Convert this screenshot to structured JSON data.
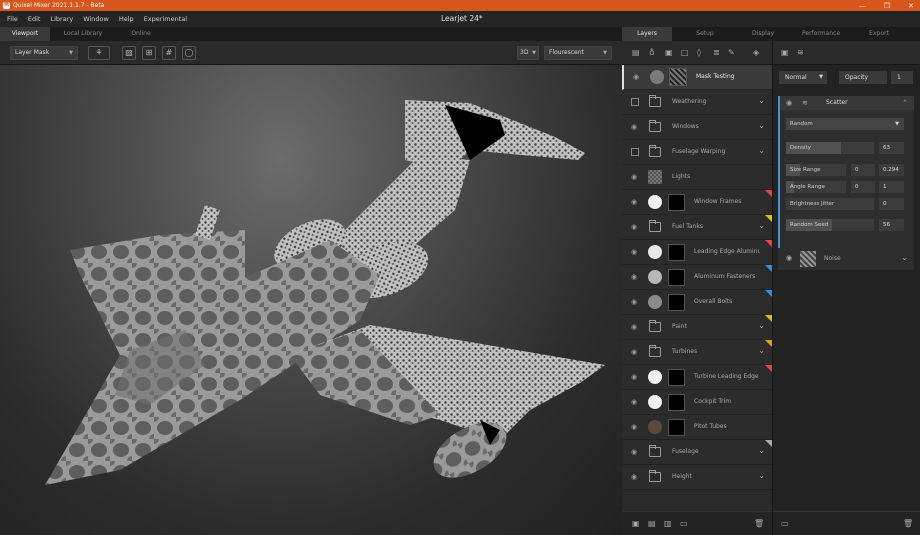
{
  "app": {
    "title": "Quixel Mixer 2021.1.1.7 - Beta",
    "logo": "M",
    "document": "Learjet 24*",
    "win_minimize": "—",
    "win_restore": "❐",
    "win_close": "✕"
  },
  "menu": [
    "File",
    "Edit",
    "Library",
    "Window",
    "Help",
    "Experimental"
  ],
  "viewport_tabs": [
    "Viewport",
    "Local Library",
    "Online"
  ],
  "viewport_toolbar": {
    "channel": "Layer Mask",
    "mode": "3D",
    "lighting": "Flourescent"
  },
  "panel_tabs": [
    "Layers",
    "Setup",
    "Display",
    "Performance",
    "Export"
  ],
  "layers": [
    {
      "name": "Mask Testing",
      "control": "eye",
      "icon": "swatch",
      "color": "#7a7a7a",
      "thumb": "pattern",
      "selected": true
    },
    {
      "name": "Weathering",
      "control": "check",
      "icon": "folder"
    },
    {
      "name": "Windows",
      "control": "eye",
      "icon": "folder"
    },
    {
      "name": "Fuselage Warping",
      "control": "check",
      "icon": "folder"
    },
    {
      "name": "Lights",
      "control": "eye",
      "icon": "checker"
    },
    {
      "name": "Window Frames",
      "control": "eye",
      "icon": "swatch",
      "color": "#f0f0f0",
      "thumb": "black",
      "tag": "#e04848"
    },
    {
      "name": "Fuel Tanks",
      "control": "eye",
      "icon": "folder",
      "tag": "#e0c020"
    },
    {
      "name": "Leading Edge Aluminum",
      "control": "eye",
      "icon": "swatch",
      "color": "#e8e8e8",
      "thumb": "black",
      "tag": "#e04848"
    },
    {
      "name": "Aluminum Fasteners",
      "control": "eye",
      "icon": "swatch",
      "color": "#b8b8b8",
      "thumb": "black",
      "tag": "#3a8ee0"
    },
    {
      "name": "Overall Bolts",
      "control": "eye",
      "icon": "swatch",
      "color": "#8a8a8a",
      "thumb": "black",
      "tag": "#3a8ee0"
    },
    {
      "name": "Paint",
      "control": "eye",
      "icon": "folder",
      "tag": "#e0c020"
    },
    {
      "name": "Turbines",
      "control": "eye",
      "icon": "folder",
      "tag": "#e0a020"
    },
    {
      "name": "Turbine Leading Edge",
      "control": "eye",
      "icon": "swatch",
      "color": "#f0f0f0",
      "thumb": "black",
      "tag": "#e04848"
    },
    {
      "name": "Cockpit Trim",
      "control": "eye",
      "icon": "swatch",
      "color": "#f0f0f0",
      "thumb": "black"
    },
    {
      "name": "Pitot Tubes",
      "control": "eye",
      "icon": "swatch",
      "color": "#5a4a3e",
      "thumb": "black"
    },
    {
      "name": "Fuselage",
      "control": "eye",
      "icon": "folder",
      "tag": "#aaaaaa"
    },
    {
      "name": "Height",
      "control": "eye",
      "icon": "folder"
    }
  ],
  "properties": {
    "blend_mode": "Normal",
    "opacity_label": "Opacity",
    "opacity_value": "1",
    "scatter": {
      "title": "Scatter",
      "mode": "Random",
      "density_label": "Density",
      "density": "63",
      "size_range_label": "Size Range",
      "size_min": "0",
      "size_max": "0.294",
      "angle_range_label": "Angle Range",
      "angle_min": "0",
      "angle_max": "1",
      "brightness_label": "Brightness Jitter",
      "brightness": "0",
      "seed_label": "Random Seed",
      "seed": "56"
    },
    "noise": {
      "title": "Noise"
    }
  }
}
